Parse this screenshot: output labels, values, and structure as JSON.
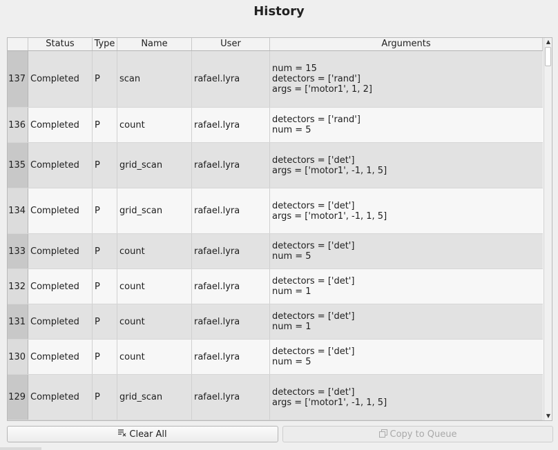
{
  "window": {
    "title": "History"
  },
  "table": {
    "columns": [
      "Status",
      "Type",
      "Name",
      "User",
      "Arguments"
    ],
    "rows": [
      {
        "index": "137",
        "status": "Completed",
        "type": "P",
        "name": "scan",
        "user": "rafael.lyra",
        "args": [
          "num = 15",
          "detectors = ['rand']",
          "args = ['motor1', 1, 2]"
        ]
      },
      {
        "index": "136",
        "status": "Completed",
        "type": "P",
        "name": "count",
        "user": "rafael.lyra",
        "args": [
          "detectors = ['rand']",
          "num = 5"
        ]
      },
      {
        "index": "135",
        "status": "Completed",
        "type": "P",
        "name": "grid_scan",
        "user": "rafael.lyra",
        "args": [
          "detectors = ['det']",
          "args = ['motor1', -1, 1, 5]"
        ]
      },
      {
        "index": "134",
        "status": "Completed",
        "type": "P",
        "name": "grid_scan",
        "user": "rafael.lyra",
        "args": [
          "detectors = ['det']",
          "args = ['motor1', -1, 1, 5]"
        ]
      },
      {
        "index": "133",
        "status": "Completed",
        "type": "P",
        "name": "count",
        "user": "rafael.lyra",
        "args": [
          "detectors = ['det']",
          "num = 5"
        ]
      },
      {
        "index": "132",
        "status": "Completed",
        "type": "P",
        "name": "count",
        "user": "rafael.lyra",
        "args": [
          "detectors = ['det']",
          "num = 1"
        ]
      },
      {
        "index": "131",
        "status": "Completed",
        "type": "P",
        "name": "count",
        "user": "rafael.lyra",
        "args": [
          "detectors = ['det']",
          "num = 1"
        ]
      },
      {
        "index": "130",
        "status": "Completed",
        "type": "P",
        "name": "count",
        "user": "rafael.lyra",
        "args": [
          "detectors = ['det']",
          "num = 5"
        ]
      },
      {
        "index": "129",
        "status": "Completed",
        "type": "P",
        "name": "grid_scan",
        "user": "rafael.lyra",
        "args": [
          "detectors = ['det']",
          "args = ['motor1', -1, 1, 5]"
        ]
      }
    ]
  },
  "buttons": {
    "clear_all": {
      "label": "Clear All",
      "icon": "clear-list-icon"
    },
    "copy_to_queue": {
      "label": "Copy to Queue",
      "icon": "copy-icon",
      "enabled": false
    }
  }
}
